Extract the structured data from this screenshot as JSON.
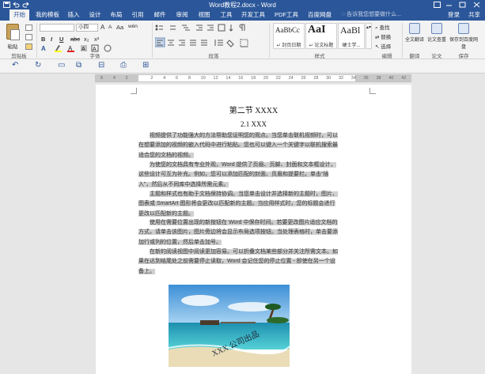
{
  "window": {
    "title": "Word教程2.docx - Word"
  },
  "tabs": [
    {
      "label": "开始",
      "active": true
    },
    {
      "label": "我的模板"
    },
    {
      "label": "插入"
    },
    {
      "label": "设计"
    },
    {
      "label": "布局"
    },
    {
      "label": "引用"
    },
    {
      "label": "邮件"
    },
    {
      "label": "审阅"
    },
    {
      "label": "视图"
    },
    {
      "label": "工具"
    },
    {
      "label": "开发工具"
    },
    {
      "label": "PDF工具集"
    },
    {
      "label": "百度网盘"
    }
  ],
  "tell_me": {
    "placeholder": "告诉我您想要做什么..."
  },
  "account": {
    "login": "登录",
    "share": "共享"
  },
  "ribbon": {
    "clipboard": {
      "paste": "粘贴",
      "label": "剪贴板"
    },
    "font": {
      "name_value": "",
      "size_value": "小四",
      "grow": "A",
      "shrink": "A",
      "aa": "Aa",
      "wen": "wén",
      "bold": "B",
      "italic": "I",
      "underline": "U",
      "strike": "abc",
      "subscript": "x₂",
      "superscript": "x²",
      "label": "字体"
    },
    "paragraph": {
      "label": "段落"
    },
    "styles": {
      "items": [
        {
          "preview": "AaBbCc",
          "name": "↵ 封页日期"
        },
        {
          "preview": "AaI",
          "name": "↵ 论文标题"
        },
        {
          "preview": "AaBl",
          "name": "硬士学..."
        }
      ],
      "label": "样式"
    },
    "editing": {
      "find": "查找",
      "replace": "替换",
      "select": "选择",
      "label": "编辑"
    },
    "translate": {
      "full": "全文翻译",
      "check": "论文查重",
      "save": "保存到百度网盘"
    },
    "translate_labels": {
      "full": "翻译",
      "check": "论文",
      "save": "保存"
    }
  },
  "ruler": {
    "ticks": [
      "8",
      "4",
      "2",
      "",
      "2",
      "4",
      "6",
      "8",
      "10",
      "12",
      "14",
      "16",
      "18",
      "20",
      "22",
      "24",
      "26",
      "28",
      "30",
      "32",
      "34",
      "36",
      "38",
      "40",
      "42"
    ]
  },
  "document": {
    "section_title": "第二节  XXXX",
    "subsection": "2.1 XXX",
    "paragraphs": [
      "视频提供了功能强大的方法帮助您证明您的观点。当您单击联机视频时，可以在想要添加的视频的嵌入代码中进行粘贴。您也可以键入一个关键字以联机搜索最适合您的文档的视频。",
      "为使您的文档具有专业外观，Word 提供了页眉、页脚、封面和文本框设计，这些设计可互为补充。例如，您可以添加匹配的封面、页眉和提要栏。单击“插入”，然后从不同库中选择所需元素。",
      "主题和样式也有助于文档保持协调。当您单击设计并选择新的主题时，图片、图表或 SmartArt 图形将会更改以匹配新的主题。当应用样式时，您的标题会进行更改以匹配新的主题。",
      "使用在需要位置出现的新按钮在 Word 中保存时间。若要更改图片适应文档的方式，请单击该图片，图片旁边将会显示布局选项按钮。当处理表格时，单击要添加行或列的位置，然后单击加号。",
      "在新的阅读视图中阅读更加容易。可以折叠文档某些部分并关注所需文本。如果在达到结尾处之前需要停止读取，Word 会记住您的停止位置 - 即使在另一个设备上。"
    ],
    "image_caption": "XXX 公司出品"
  },
  "colors": {
    "accent": "#2b579a",
    "highlight": "#d0d0d0",
    "ribbon": "#f3f3f3",
    "canvas": "#e6e6e6"
  },
  "icons": {
    "save": "save-icon",
    "undo": "undo-icon",
    "redo": "redo-icon",
    "paste": "paste-icon"
  }
}
